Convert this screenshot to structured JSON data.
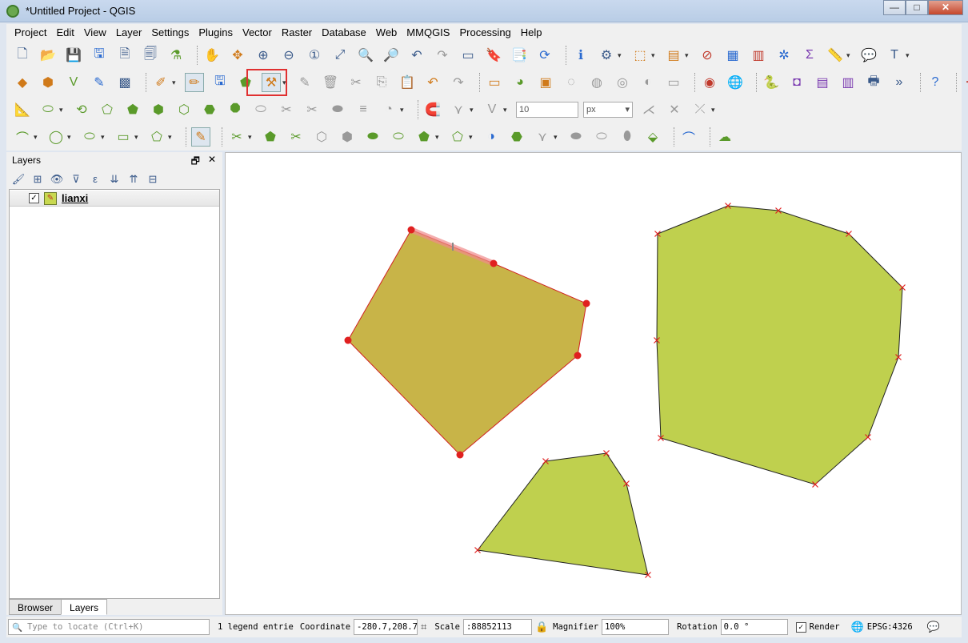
{
  "window": {
    "title": "*Untitled Project - QGIS",
    "buttons": [
      "—",
      "□",
      "✕"
    ]
  },
  "menubar": {
    "items": [
      "Project",
      "Edit",
      "View",
      "Layer",
      "Settings",
      "Plugins",
      "Vector",
      "Raster",
      "Database",
      "Web",
      "MMQGIS",
      "Processing",
      "Help"
    ]
  },
  "toolbar": {
    "snap_tolerance": "10",
    "snap_units": "px"
  },
  "layers_panel": {
    "title": "Layers",
    "float_glyph": "🗗",
    "close_glyph": "✕",
    "layer_name": "lianxi",
    "layer_checked": "✓",
    "tabs": [
      "Browser",
      "Layers"
    ]
  },
  "status": {
    "locator_placeholder": "Type to locate (Ctrl+K)",
    "legend_info": "1 legend entrie",
    "coordinate_label": "Coordinate",
    "coordinate_value": "-280.7,208.7",
    "scale_label": "Scale",
    "scale_value": ":88852113",
    "magnifier_label": "Magnifier",
    "magnifier_value": "100%",
    "rotation_label": "Rotation",
    "rotation_value": "0.0 °",
    "render_label": "Render",
    "render_checked": "✓",
    "crs": "EPSG:4326"
  },
  "colors": {
    "selected_fill": "#c8b448",
    "polygon_fill": "#bfd04e",
    "vertex_red": "#e02020",
    "highlight_box": "#e03030"
  }
}
